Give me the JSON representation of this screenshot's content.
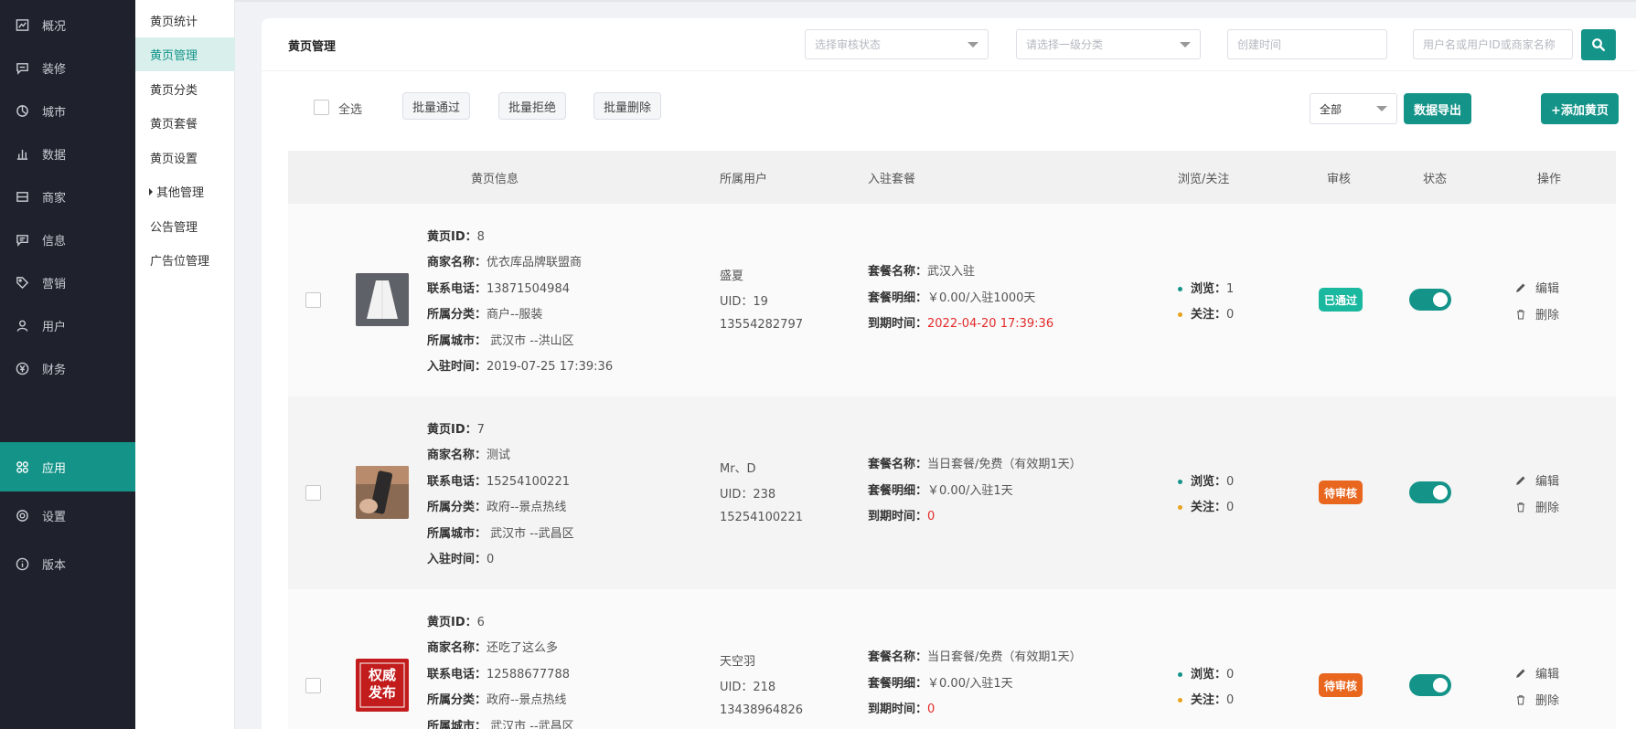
{
  "sidebar": {
    "items": [
      {
        "label": "概况",
        "icon": "dashboard-icon"
      },
      {
        "label": "装修",
        "icon": "chat-icon"
      },
      {
        "label": "城市",
        "icon": "city-icon"
      },
      {
        "label": "数据",
        "icon": "bar-chart-icon"
      },
      {
        "label": "商家",
        "icon": "store-icon"
      },
      {
        "label": "信息",
        "icon": "message-icon"
      },
      {
        "label": "营销",
        "icon": "tag-icon"
      },
      {
        "label": "用户",
        "icon": "user-icon"
      },
      {
        "label": "财务",
        "icon": "yen-icon"
      },
      {
        "label": "应用",
        "icon": "apps-icon",
        "active": true
      },
      {
        "label": "设置",
        "icon": "gear-icon"
      },
      {
        "label": "版本",
        "icon": "info-icon"
      }
    ]
  },
  "submenu": {
    "items": [
      {
        "label": "黄页统计"
      },
      {
        "label": "黄页管理",
        "active": true
      },
      {
        "label": "黄页分类"
      },
      {
        "label": "黄页套餐"
      },
      {
        "label": "黄页设置"
      },
      {
        "label": "其他管理",
        "expandable": true
      },
      {
        "label": "公告管理"
      },
      {
        "label": "广告位管理"
      }
    ]
  },
  "header": {
    "title": "黄页管理",
    "filters": {
      "audit_status_placeholder": "选择审核状态",
      "category_placeholder": "请选择一级分类",
      "created_time_placeholder": "创建时间",
      "keyword_placeholder": "用户名或用户ID或商家名称"
    }
  },
  "toolbar": {
    "select_all": "全选",
    "batch_approve": "批量通过",
    "batch_reject": "批量拒绝",
    "batch_delete": "批量删除",
    "scope_select": "全部",
    "export": "数据导出",
    "add": "+添加黄页"
  },
  "table": {
    "columns": [
      "黄页信息",
      "所属用户",
      "入驻套餐",
      "浏览/关注",
      "审核",
      "状态",
      "操作"
    ],
    "labels": {
      "id": "黄页ID：",
      "name": "商家名称：",
      "phone": "联系电话：",
      "category": "所属分类：",
      "city": "所属城市：",
      "joined": "入驻时间：",
      "pkg_name": "套餐名称：",
      "pkg_detail": "套餐明细：",
      "expire": "到期时间：",
      "views": "浏览：",
      "follows": "关注：",
      "edit": "编辑",
      "delete": "删除"
    },
    "rows": [
      {
        "id": "8",
        "name": "优衣库品牌联盟商",
        "phone": "13871504984",
        "category": "商户--服装",
        "city": " 武汉市 --洪山区",
        "joined": "2019-07-25 17:39:36",
        "user_name": "盛夏",
        "uid": "UID：19",
        "user_phone": "13554282797",
        "pkg_name": "武汉入驻",
        "pkg_detail": "￥0.00/入驻1000天",
        "expire": "2022-04-20 17:39:36",
        "views": "1",
        "follows": "0",
        "audit": "已通过",
        "audit_color": "#1bb8a0",
        "thumb": "clothing-photo"
      },
      {
        "id": "7",
        "name": "测试",
        "phone": "15254100221",
        "category": "政府--景点热线",
        "city": " 武汉市 --武昌区",
        "joined": "0",
        "user_name": "Mr、D",
        "uid": "UID：238",
        "user_phone": "15254100221",
        "pkg_name": "当日套餐/免费（有效期1天）",
        "pkg_detail": "￥0.00/入驻1天",
        "expire": "0",
        "views": "0",
        "follows": "0",
        "audit": "待审核",
        "audit_color": "#e8661e",
        "thumb": "phone-photo"
      },
      {
        "id": "6",
        "name": "还吃了这么多",
        "phone": "12588677788",
        "category": "政府--景点热线",
        "city": " 武汉市 --武昌区",
        "joined": "",
        "user_name": "天空羽",
        "uid": "UID：218",
        "user_phone": "13438964826",
        "pkg_name": "当日套餐/免费（有效期1天）",
        "pkg_detail": "￥0.00/入驻1天",
        "expire": "0",
        "views": "0",
        "follows": "0",
        "audit": "待审核",
        "audit_color": "#e8661e",
        "thumb": "news-logo",
        "thumb_text_1": "权威",
        "thumb_text_2": "发布"
      }
    ]
  }
}
